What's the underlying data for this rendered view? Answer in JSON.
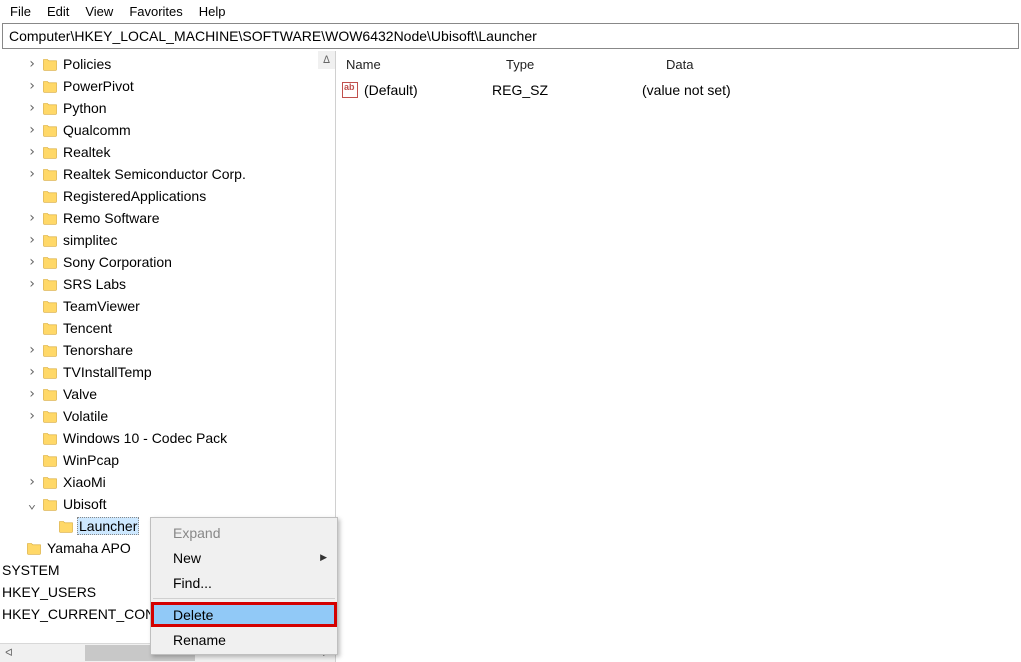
{
  "menu": {
    "file": "File",
    "edit": "Edit",
    "view": "View",
    "favorites": "Favorites",
    "help": "Help"
  },
  "address": "Computer\\HKEY_LOCAL_MACHINE\\SOFTWARE\\WOW6432Node\\Ubisoft\\Launcher",
  "tree": [
    {
      "indent": 1,
      "tw": ">",
      "label": "Policies"
    },
    {
      "indent": 1,
      "tw": ">",
      "label": "PowerPivot"
    },
    {
      "indent": 1,
      "tw": ">",
      "label": "Python"
    },
    {
      "indent": 1,
      "tw": ">",
      "label": "Qualcomm"
    },
    {
      "indent": 1,
      "tw": ">",
      "label": "Realtek"
    },
    {
      "indent": 1,
      "tw": ">",
      "label": "Realtek Semiconductor Corp."
    },
    {
      "indent": 1,
      "tw": "",
      "label": "RegisteredApplications"
    },
    {
      "indent": 1,
      "tw": ">",
      "label": "Remo Software"
    },
    {
      "indent": 1,
      "tw": ">",
      "label": "simplitec"
    },
    {
      "indent": 1,
      "tw": ">",
      "label": "Sony Corporation"
    },
    {
      "indent": 1,
      "tw": ">",
      "label": "SRS Labs"
    },
    {
      "indent": 1,
      "tw": "",
      "label": "TeamViewer"
    },
    {
      "indent": 1,
      "tw": "",
      "label": "Tencent"
    },
    {
      "indent": 1,
      "tw": ">",
      "label": "Tenorshare"
    },
    {
      "indent": 1,
      "tw": ">",
      "label": "TVInstallTemp"
    },
    {
      "indent": 1,
      "tw": ">",
      "label": "Valve"
    },
    {
      "indent": 1,
      "tw": ">",
      "label": "Volatile"
    },
    {
      "indent": 1,
      "tw": "",
      "label": "Windows 10 - Codec Pack"
    },
    {
      "indent": 1,
      "tw": "",
      "label": "WinPcap"
    },
    {
      "indent": 1,
      "tw": ">",
      "label": "XiaoMi"
    },
    {
      "indent": 1,
      "tw": "v",
      "label": "Ubisoft"
    },
    {
      "indent": 2,
      "tw": "",
      "label": "Launcher",
      "selected": true
    },
    {
      "indent": 0,
      "tw": "",
      "label": "Yamaha APO"
    },
    {
      "indent": -1,
      "tw": "",
      "label": "SYSTEM",
      "nofolder": true,
      "shift": -6
    },
    {
      "indent": -1,
      "tw": "",
      "label": "HKEY_USERS",
      "nofolder": true,
      "shift": -22
    },
    {
      "indent": -1,
      "tw": "",
      "label": "HKEY_CURRENT_CON",
      "nofolder": true,
      "shift": -22
    }
  ],
  "list": {
    "headers": {
      "name": "Name",
      "type": "Type",
      "data": "Data"
    },
    "rows": [
      {
        "name": "(Default)",
        "type": "REG_SZ",
        "data": "(value not set)"
      }
    ]
  },
  "context_menu": [
    {
      "label": "Expand",
      "kind": "disabled"
    },
    {
      "label": "New",
      "kind": "submenu"
    },
    {
      "label": "Find...",
      "kind": "item"
    },
    {
      "sep": true
    },
    {
      "label": "Delete",
      "kind": "selected-highlight"
    },
    {
      "label": "Rename",
      "kind": "item"
    }
  ],
  "scroll": {
    "left": "ᐊ",
    "right": "ᐅ",
    "up": "ᐃ"
  }
}
